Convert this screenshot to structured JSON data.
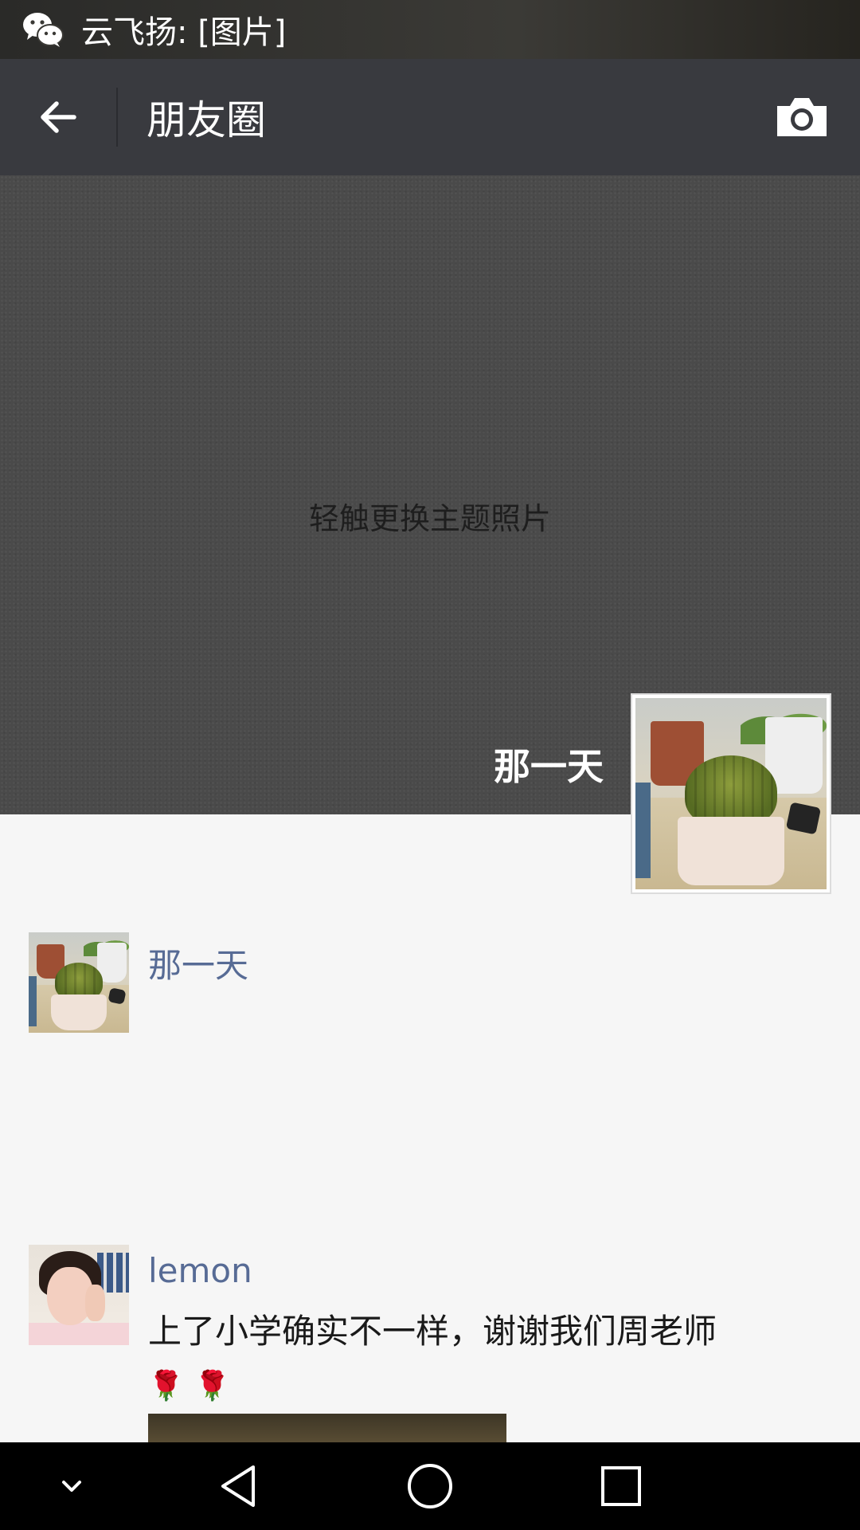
{
  "status_bar": {
    "notification_icon": "wechat-icon",
    "notification_text": "云飞扬: [图片]"
  },
  "header": {
    "back_icon": "back-arrow-icon",
    "title": "朋友圈",
    "camera_icon": "camera-icon"
  },
  "cover": {
    "hint": "轻触更换主题照片",
    "user_name": "那一天"
  },
  "feed": [
    {
      "nickname": "那一天",
      "text": ""
    },
    {
      "nickname": "lemon",
      "text": "上了小学确实不一样，谢谢我们周老师",
      "emoji": [
        "🌹",
        "🌹"
      ]
    }
  ],
  "nav_bar": {
    "icons": [
      "chevron-down-icon",
      "back-triangle-icon",
      "home-circle-icon",
      "recents-square-icon"
    ]
  },
  "colors": {
    "title_bar": "#393a3f",
    "nickname": "#576b95",
    "background": "#f6f6f6"
  }
}
